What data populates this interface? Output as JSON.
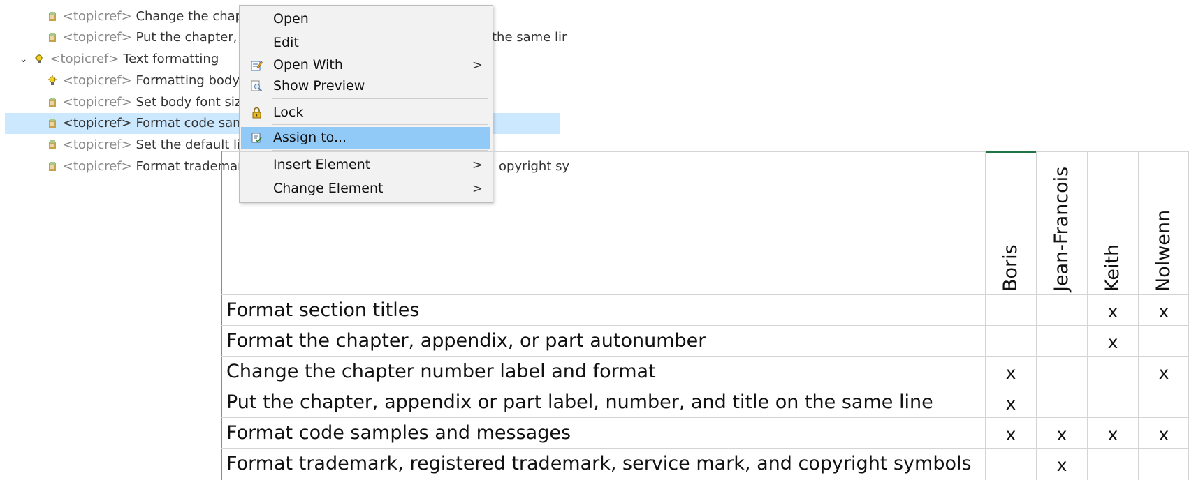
{
  "tree": {
    "items": [
      {
        "tag": "<topicref>",
        "label": "Change the chapte",
        "icon": "topic-icon"
      },
      {
        "tag": "<topicref>",
        "label": "Put the chapter, ap",
        "icon": "topic-icon",
        "tail": "the same lir"
      },
      {
        "tag": "<topicref>",
        "label": "Text formatting",
        "icon": "lightbulb-icon",
        "expanded": true
      },
      {
        "tag": "<topicref>",
        "label": "Formatting body t",
        "icon": "lightbulb-icon"
      },
      {
        "tag": "<topicref>",
        "label": "Set body font sizes",
        "icon": "topic-icon"
      },
      {
        "tag": "<topicref>",
        "label": "Format code samp",
        "icon": "topic-icon",
        "selected": true
      },
      {
        "tag": "<topicref>",
        "label": "Set the default line",
        "icon": "topic-icon"
      },
      {
        "tag": "<topicref>",
        "label": "Format trademark,",
        "icon": "topic-icon",
        "tail": "opyright sy"
      }
    ]
  },
  "context_menu": {
    "items": [
      {
        "label": "Open"
      },
      {
        "label": "Edit"
      },
      {
        "label": "Open With",
        "icon": "open-with-icon",
        "submenu": true
      },
      {
        "label": "Show Preview",
        "icon": "preview-icon"
      },
      {
        "label": "Lock",
        "icon": "lock-icon"
      },
      {
        "label": "Assign to...",
        "icon": "assign-icon",
        "highlighted": true
      },
      {
        "label": "Insert Element",
        "submenu": true
      },
      {
        "label": "Change Element",
        "submenu": true
      }
    ],
    "submenu_arrow": ">"
  },
  "sheet": {
    "assignees": [
      "Boris",
      "Jean-Francois",
      "Keith",
      "Nolwenn"
    ],
    "tasks": [
      {
        "name": "Format section titles",
        "marks": [
          "",
          "",
          "x",
          "x"
        ]
      },
      {
        "name": "Format the chapter, appendix, or part autonumber",
        "marks": [
          "",
          "",
          "x",
          ""
        ]
      },
      {
        "name": "Change the chapter number label and format",
        "marks": [
          "x",
          "",
          "",
          "x"
        ]
      },
      {
        "name": "Put the chapter, appendix or part label, number, and title on the same line",
        "marks": [
          "x",
          "",
          "",
          ""
        ]
      },
      {
        "name": "Format code samples and messages",
        "marks": [
          "x",
          "x",
          "x",
          "x"
        ]
      },
      {
        "name": "Format trademark, registered trademark, service mark, and copyright symbols",
        "marks": [
          "",
          "x",
          "",
          ""
        ]
      }
    ],
    "accent_color": "#217346"
  },
  "colors": {
    "selection_row": "#cce8ff",
    "menu_highlight": "#91c9f7",
    "menu_background": "#f2f2f2"
  }
}
